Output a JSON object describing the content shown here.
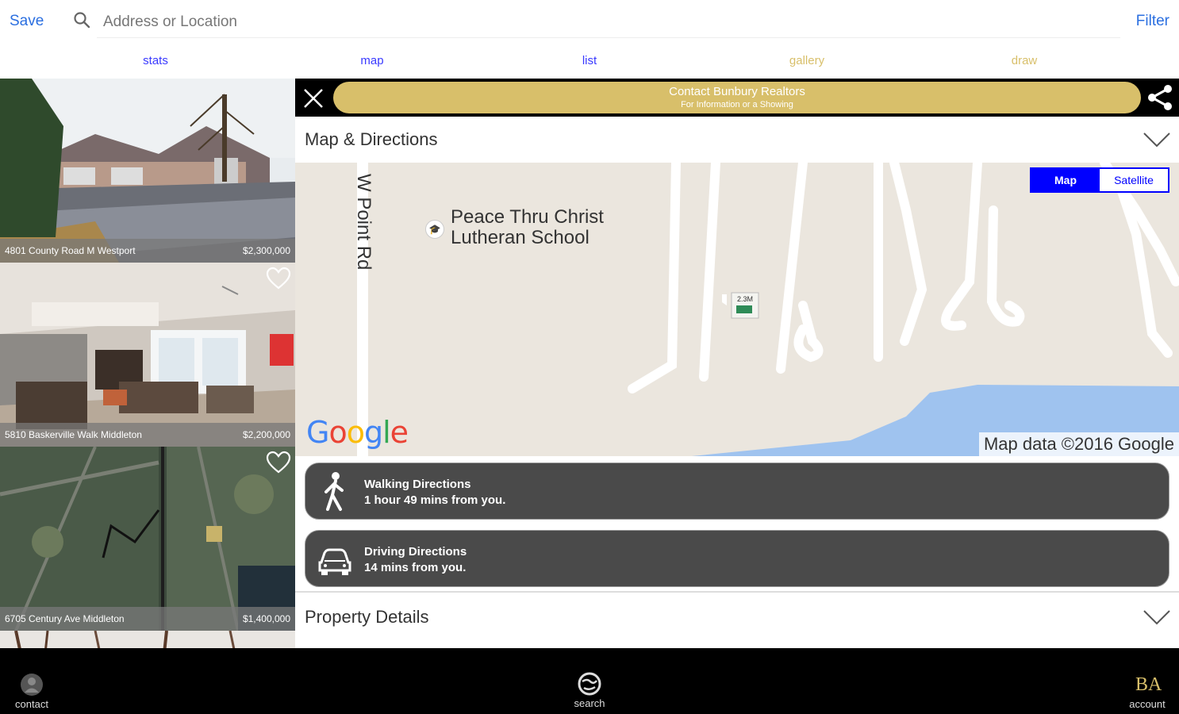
{
  "topbar": {
    "save_label": "Save",
    "search_placeholder": "Address or Location",
    "filter_label": "Filter"
  },
  "tabs": [
    {
      "label": "stats",
      "color": "#3a3aff"
    },
    {
      "label": "map",
      "color": "#3a3aff"
    },
    {
      "label": "list",
      "color": "#3a3aff"
    },
    {
      "label": "gallery",
      "color": "#d8bf6a"
    },
    {
      "label": "draw",
      "color": "#d8bf6a"
    }
  ],
  "listings": [
    {
      "address": "4801 County Road M Westport",
      "price": "$2,300,000"
    },
    {
      "address": "5810 Baskerville Walk Middleton",
      "price": "$2,200,000"
    },
    {
      "address": "6705 Century Ave Middleton",
      "price": "$1,400,000"
    }
  ],
  "contact": {
    "title": "Contact Bunbury Realtors",
    "subtitle": "For Information or a Showing"
  },
  "sections": {
    "map_directions": "Map & Directions",
    "property_details": "Property Details"
  },
  "map": {
    "toggle_map": "Map",
    "toggle_satellite": "Satellite",
    "road_label": "W Point Rd",
    "school_line1": "Peace Thru Christ",
    "school_line2": "Lutheran School",
    "marker_label": "2.3M",
    "logo": "Google",
    "attribution": "Map data ©2016 Google"
  },
  "directions": {
    "walking_title": "Walking Directions",
    "walking_time": "1 hour 49 mins from you.",
    "driving_title": "Driving Directions",
    "driving_time": "14 mins from you."
  },
  "bottom_nav": {
    "contact": "contact",
    "search": "search",
    "account": "account",
    "account_logo": "BA"
  },
  "colors": {
    "accent_blue": "#2b6fe0",
    "gold": "#d8bf6a",
    "button_dark": "#4a4a4a"
  }
}
